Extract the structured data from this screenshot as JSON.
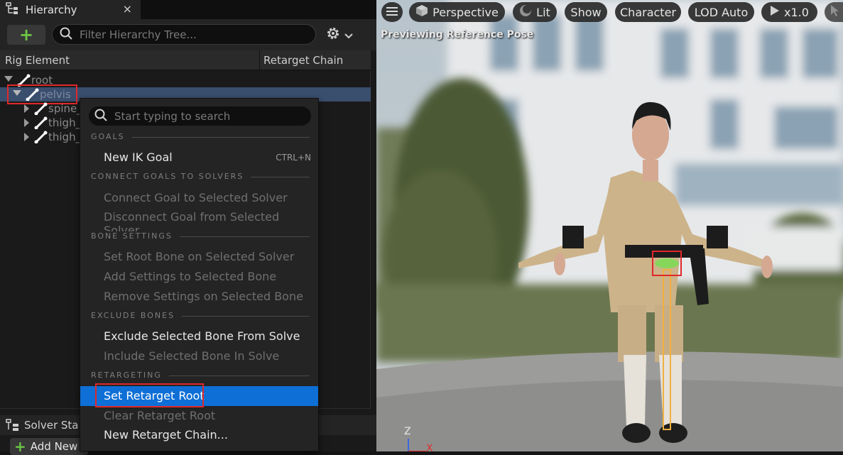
{
  "hierarchy_tab": {
    "title": "Hierarchy",
    "close": "×"
  },
  "hierarchy_toolbar": {
    "add": "+",
    "search_placeholder": "Filter Hierarchy Tree..."
  },
  "columns": {
    "rig_element": "Rig Element",
    "retarget_chain": "Retarget Chain"
  },
  "tree": {
    "root": "root",
    "pelvis": "pelvis",
    "spine": "spine_",
    "thigh_l": "thigh_",
    "thigh_r": "thigh_"
  },
  "solver_stack": {
    "title": "Solver Sta",
    "add_new": "Add New"
  },
  "context_menu": {
    "search_placeholder": "Start typing to search",
    "sections": {
      "goals": "GOALS",
      "connect": "CONNECT GOALS TO SOLVERS",
      "bone_settings": "BONE SETTINGS",
      "exclude": "EXCLUDE BONES",
      "retargeting": "RETARGETING"
    },
    "items": {
      "new_ik_goal": "New IK Goal",
      "new_ik_goal_shortcut": "CTRL+N",
      "connect_goal": "Connect Goal to Selected Solver",
      "disconnect_goal": "Disconnect Goal from Selected Solver",
      "set_root_bone": "Set Root Bone on Selected Solver",
      "add_settings": "Add Settings to Selected Bone",
      "remove_settings": "Remove Settings on Selected Bone",
      "exclude_bone": "Exclude Selected Bone From Solve",
      "include_bone": "Include Selected Bone In Solve",
      "set_retarget_root": "Set Retarget Root",
      "clear_retarget_root": "Clear Retarget Root",
      "new_retarget_chain": "New Retarget Chain..."
    }
  },
  "viewport": {
    "toolbar": {
      "perspective": "Perspective",
      "lit": "Lit",
      "show": "Show",
      "character": "Character",
      "lod": "LOD Auto",
      "speed": "x1.0"
    },
    "preview_label": "Previewing Reference Pose",
    "axis_z": "Z",
    "axis_x": "X"
  },
  "colors": {
    "selection": "#0e6fd6",
    "highlight_box": "#e0282a",
    "add_green": "#6cc644"
  }
}
